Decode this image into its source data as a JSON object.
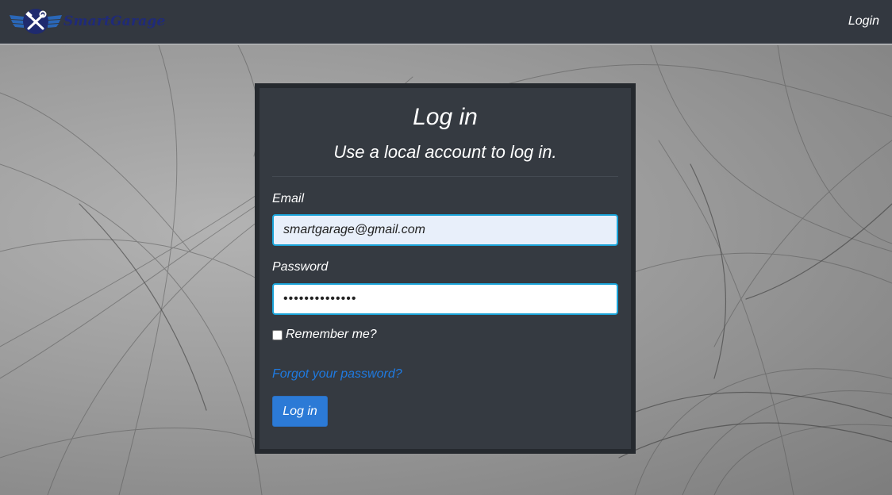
{
  "navbar": {
    "brand_name": "SmartGarage",
    "login_link": "Login"
  },
  "login_form": {
    "title": "Log in",
    "subtitle": "Use a local account to log in.",
    "email_label": "Email",
    "email_value": "smartgarage@gmail.com",
    "password_label": "Password",
    "password_value": "••••••••••••••",
    "remember_label": "Remember me?",
    "remember_checked": false,
    "forgot_link": "Forgot your password?",
    "submit_label": "Log in"
  },
  "colors": {
    "navbar_bg": "#333840",
    "card_bg": "#353a41",
    "accent_blue": "#2c7ad6",
    "link_blue": "#1f7ae0",
    "focus_border": "#1aa3d8"
  },
  "icons": {
    "brand_logo": "wrench-hammer-wings-logo"
  }
}
